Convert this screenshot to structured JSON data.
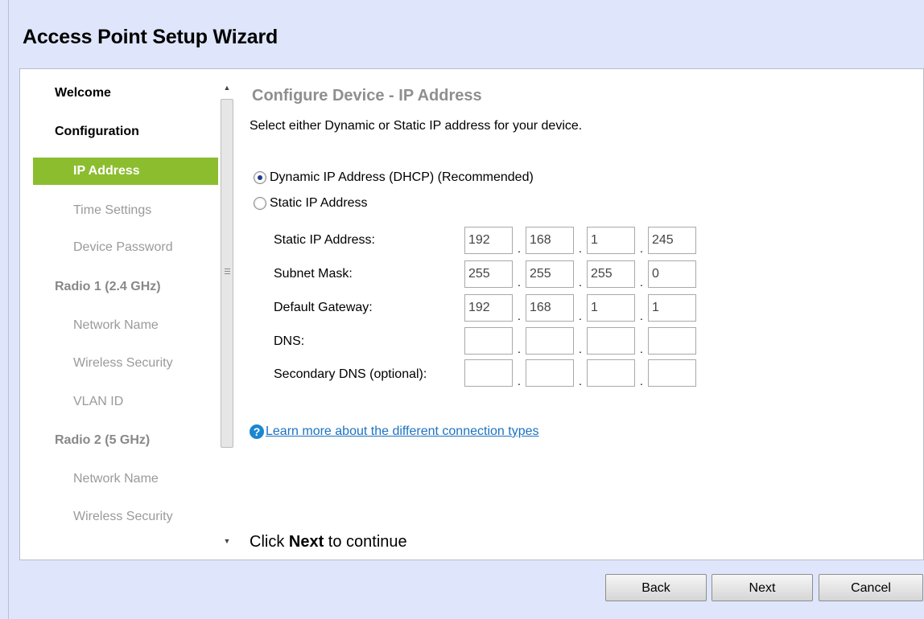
{
  "window": {
    "title": "Access Point Setup Wizard"
  },
  "sidebar": {
    "welcome": "Welcome",
    "configuration": "Configuration",
    "ip_address": "IP Address",
    "time_settings": "Time Settings",
    "device_password": "Device Password",
    "radio1": "Radio 1 (2.4 GHz)",
    "radio1_network_name": "Network Name",
    "radio1_wireless_security": "Wireless Security",
    "radio1_vlan_id": "VLAN ID",
    "radio2": "Radio 2 (5 GHz)",
    "radio2_network_name": "Network Name",
    "radio2_wireless_security": "Wireless Security",
    "accent_color": "#8cbd2f"
  },
  "main": {
    "section_title": "Configure Device - IP Address",
    "description": "Select either Dynamic or Static IP address for your device.",
    "radio_dynamic": "Dynamic IP Address (DHCP) (Recommended)",
    "radio_static": "Static IP Address",
    "selected_mode": "dynamic",
    "fields": {
      "static_ip": {
        "label": "Static IP Address:",
        "octets": [
          "192",
          "168",
          "1",
          "245"
        ]
      },
      "subnet_mask": {
        "label": "Subnet Mask:",
        "octets": [
          "255",
          "255",
          "255",
          "0"
        ]
      },
      "default_gateway": {
        "label": "Default Gateway:",
        "octets": [
          "192",
          "168",
          "1",
          "1"
        ]
      },
      "dns": {
        "label": "DNS:",
        "octets": [
          "",
          "",
          "",
          ""
        ]
      },
      "secondary_dns": {
        "label": "Secondary DNS (optional):",
        "octets": [
          "",
          "",
          "",
          ""
        ]
      }
    },
    "help_link": "Learn more about the different connection types",
    "help_icon": "question-circle-icon",
    "footer_pre": "Click ",
    "footer_bold": "Next",
    "footer_post": " to continue"
  },
  "buttons": {
    "back": "Back",
    "next": "Next",
    "cancel": "Cancel"
  }
}
